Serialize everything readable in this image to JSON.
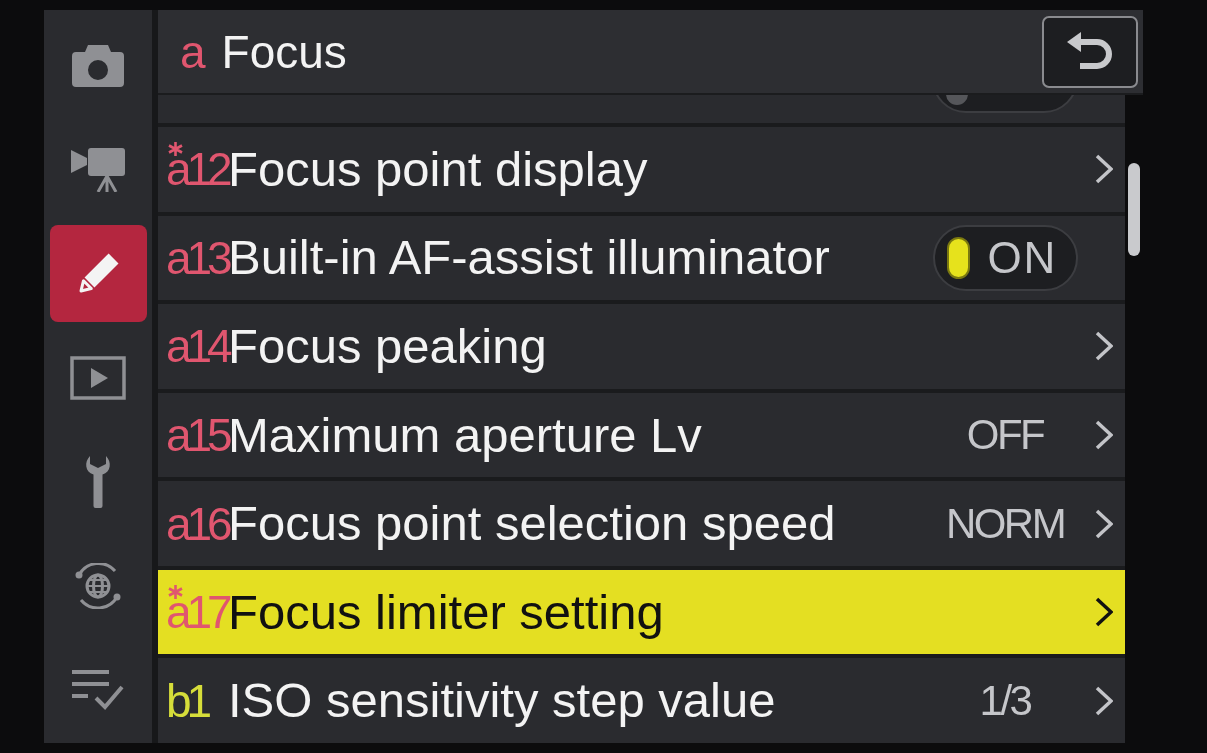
{
  "sidebar": {
    "items": [
      {
        "kind": "camera",
        "selected": false
      },
      {
        "kind": "movie-camera",
        "selected": false
      },
      {
        "kind": "pencil",
        "selected": true
      },
      {
        "kind": "playback",
        "selected": false
      },
      {
        "kind": "wrench",
        "selected": false
      },
      {
        "kind": "globe",
        "selected": false
      },
      {
        "kind": "checklist",
        "selected": false
      }
    ]
  },
  "header": {
    "code": "a",
    "title": "Focus"
  },
  "rows": [
    {
      "kind": "clipped_toggle",
      "on": false,
      "selected": false
    },
    {
      "kind": "submenu",
      "code": "a12",
      "color": "#e0566f",
      "modified": true,
      "label": "Focus point display",
      "selected": false
    },
    {
      "kind": "toggle",
      "code": "a13",
      "color": "#e0566f",
      "modified": false,
      "label": "Built-in AF-assist illuminator",
      "on": true,
      "toggle_label": "ON",
      "selected": false
    },
    {
      "kind": "submenu",
      "code": "a14",
      "color": "#e0566f",
      "modified": false,
      "label": "Focus peaking",
      "selected": false
    },
    {
      "kind": "submenu",
      "code": "a15",
      "color": "#e0566f",
      "modified": false,
      "label": "Maximum aperture Lv",
      "value": "OFF",
      "selected": false
    },
    {
      "kind": "submenu",
      "code": "a16",
      "color": "#e0566f",
      "modified": false,
      "label": "Focus point selection speed",
      "value": "NORM",
      "selected": false
    },
    {
      "kind": "submenu",
      "code": "a17",
      "color": "#e0566f",
      "modified": true,
      "label": "Focus limiter setting",
      "selected": true
    },
    {
      "kind": "submenu",
      "code": "b1",
      "color": "#d6dd3a",
      "modified": false,
      "label": "ISO sensitivity step value",
      "value": "1/3",
      "selected": false
    }
  ]
}
